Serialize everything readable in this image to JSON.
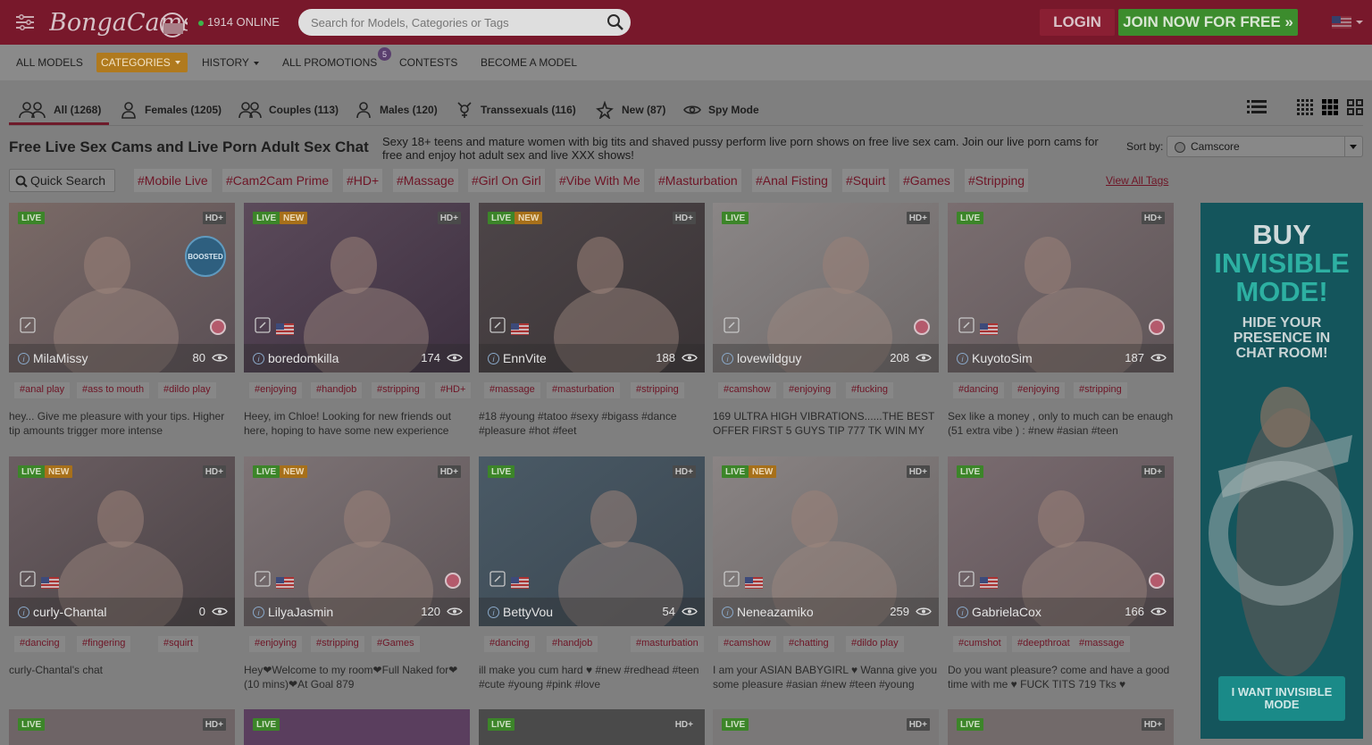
{
  "header": {
    "online_count": "1914 ONLINE",
    "search_placeholder": "Search for Models, Categories or Tags",
    "login_label": "LOGIN",
    "join_label": "JOIN NOW FOR FREE »"
  },
  "subnav": {
    "all_models": "ALL MODELS",
    "categories": "CATEGORIES",
    "history": "HISTORY",
    "all_promotions": "ALL PROMOTIONS",
    "promotions_badge": "5",
    "contests": "CONTESTS",
    "become_model": "BECOME A MODEL"
  },
  "tabs": [
    {
      "label": "All (1268)",
      "icon": "all-icon"
    },
    {
      "label": "Females (1205)",
      "icon": "female-icon"
    },
    {
      "label": "Couples (113)",
      "icon": "couples-icon"
    },
    {
      "label": "Males (120)",
      "icon": "male-icon"
    },
    {
      "label": "Transsexuals (116)",
      "icon": "trans-icon"
    },
    {
      "label": "New (87)",
      "icon": "new-icon"
    },
    {
      "label": "Spy Mode",
      "icon": "eye-icon"
    }
  ],
  "page": {
    "title": "Free Live Sex Cams and Live Porn Adult Sex Chat",
    "description": "Sexy 18+ teens and mature women with big tits and shaved pussy perform live porn shows on free live sex cam. Join our live porn cams for free and enjoy hot adult sex and live XXX shows!",
    "sort_label": "Sort by:",
    "sort_value": "Camscore",
    "quick_search": "Quick Search",
    "view_all_tags": "View All Tags"
  },
  "filter_tags": [
    "#Mobile Live",
    "#Cam2Cam Prime",
    "#HD+",
    "#Massage",
    "#Girl On Girl",
    "#Vibe With Me",
    "#Masturbation",
    "#Anal Fisting",
    "#Squirt",
    "#Games",
    "#Stripping"
  ],
  "badges": {
    "live": "LIVE",
    "new": "NEW",
    "hd": "HD+",
    "boosted": "BOOSTED"
  },
  "models": [
    {
      "name": "MilaMissy",
      "viewers": "80",
      "new": false,
      "boosted": true,
      "tags": [
        "#anal play",
        "#ass to mouth",
        "#dildo play"
      ],
      "subject": "hey... Give me pleasure with your tips. Higher tip amounts trigger more intense"
    },
    {
      "name": "boredomkilla",
      "viewers": "174",
      "new": true,
      "tags": [
        "#enjoying",
        "#handjob",
        "#stripping",
        "#HD+"
      ],
      "subject": "Heey, im Chloe! Looking for new friends out here, hoping to have some new experience"
    },
    {
      "name": "EnnVite",
      "viewers": "188",
      "new": true,
      "tags": [
        "#massage",
        "#masturbation",
        "#stripping"
      ],
      "subject": "#18 #young #tatoo #sexy #bigass #dance #pleasure #hot #feet"
    },
    {
      "name": "lovewildguy",
      "viewers": "208",
      "new": false,
      "tags": [
        "#camshow",
        "#enjoying",
        "#fucking"
      ],
      "subject": "169 ULTRA HIGH VIBRATIONS......THE BEST OFFER FIRST 5 GUYS TIP 777 TK WIN MY"
    },
    {
      "name": "KuyotoSim",
      "viewers": "187",
      "new": false,
      "tags": [
        "#dancing",
        "#enjoying",
        "#stripping"
      ],
      "subject": "Sex like a money , only to much can be enaugh (51 extra vibe ) : #new #asian #teen"
    },
    {
      "name": "curly-Chantal",
      "viewers": "0",
      "new": true,
      "tags": [
        "#dancing",
        "#fingering",
        "#squirt"
      ],
      "subject": "curly-Chantal's chat"
    },
    {
      "name": "LilyaJasmin",
      "viewers": "120",
      "new": true,
      "tags": [
        "#enjoying",
        "#stripping",
        "#Games"
      ],
      "subject": "Hey❤Welcome to my room❤Full Naked for❤ (10 mins)❤At Goal 879"
    },
    {
      "name": "BettyVou",
      "viewers": "54",
      "new": false,
      "tags": [
        "#dancing",
        "#handjob",
        "#masturbation"
      ],
      "subject": "ill make you cum hard ♥ #new #redhead #teen #cute #young #pink #love"
    },
    {
      "name": "Neneazamiko",
      "viewers": "259",
      "new": true,
      "tags": [
        "#camshow",
        "#chatting",
        "#dildo play"
      ],
      "subject": "I am your ASIAN BABYGIRL ♥ Wanna give you some pleasure #asian #new #teen #young"
    },
    {
      "name": "GabrielaCox",
      "viewers": "166",
      "new": false,
      "tags": [
        "#cumshot",
        "#deepthroat",
        "#massage"
      ],
      "subject": "Do you want pleasure? come and have a good time with me ♥ FUCK TITS 719 Tks ♥"
    }
  ],
  "ad": {
    "line1": "BUY",
    "line2": "INVISIBLE",
    "line3": "MODE!",
    "sub": "HIDE YOUR PRESENCE IN CHAT ROOM!",
    "button": "I WANT INVISIBLE MODE"
  },
  "colors": {
    "header": "#78182b",
    "join": "#3c8c2d",
    "category": "#b07a1e",
    "live": "#3c8529",
    "new": "#a7701a",
    "tag": "#6e1526",
    "ad": "#14555c"
  }
}
